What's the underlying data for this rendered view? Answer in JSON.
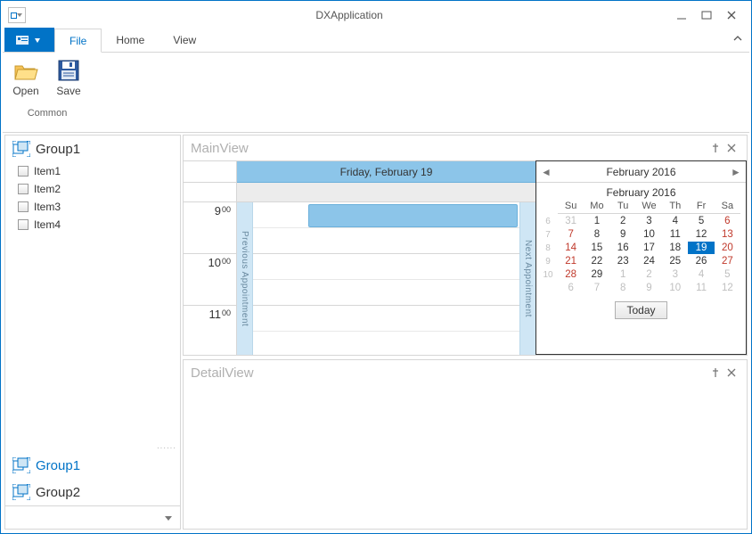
{
  "window": {
    "title": "DXApplication"
  },
  "ribbon": {
    "tabs": {
      "file": "File",
      "home": "Home",
      "view": "View"
    },
    "group_label": "Common",
    "open": "Open",
    "save": "Save"
  },
  "sidebar": {
    "group_top": "Group1",
    "items": [
      "Item1",
      "Item2",
      "Item3",
      "Item4"
    ],
    "group_a": "Group1",
    "group_b": "Group2"
  },
  "panels": {
    "main": "MainView",
    "detail": "DetailView"
  },
  "scheduler": {
    "day_header": "Friday, February 19",
    "times": [
      {
        "hour": "9",
        "min": "00"
      },
      {
        "hour": "10",
        "min": "00"
      },
      {
        "hour": "11",
        "min": "00"
      }
    ],
    "prev_label": "Previous Appointment",
    "next_label": "Next Appointment"
  },
  "calendar": {
    "nav_label": "February 2016",
    "month_label": "February 2016",
    "dow": [
      "Su",
      "Mo",
      "Tu",
      "We",
      "Th",
      "Fr",
      "Sa"
    ],
    "weeks": [
      {
        "wk": "6",
        "days": [
          {
            "d": "31",
            "o": true
          },
          {
            "d": "1"
          },
          {
            "d": "2"
          },
          {
            "d": "3"
          },
          {
            "d": "4"
          },
          {
            "d": "5"
          },
          {
            "d": "6",
            "we": true
          }
        ]
      },
      {
        "wk": "7",
        "days": [
          {
            "d": "7",
            "we": true
          },
          {
            "d": "8"
          },
          {
            "d": "9"
          },
          {
            "d": "10"
          },
          {
            "d": "11"
          },
          {
            "d": "12"
          },
          {
            "d": "13",
            "we": true
          }
        ]
      },
      {
        "wk": "8",
        "days": [
          {
            "d": "14",
            "we": true
          },
          {
            "d": "15"
          },
          {
            "d": "16"
          },
          {
            "d": "17"
          },
          {
            "d": "18"
          },
          {
            "d": "19",
            "sel": true
          },
          {
            "d": "20",
            "we": true
          }
        ]
      },
      {
        "wk": "9",
        "days": [
          {
            "d": "21",
            "we": true
          },
          {
            "d": "22"
          },
          {
            "d": "23"
          },
          {
            "d": "24"
          },
          {
            "d": "25"
          },
          {
            "d": "26"
          },
          {
            "d": "27",
            "we": true
          }
        ]
      },
      {
        "wk": "10",
        "days": [
          {
            "d": "28",
            "we": true
          },
          {
            "d": "29"
          },
          {
            "d": "1",
            "o": true
          },
          {
            "d": "2",
            "o": true
          },
          {
            "d": "3",
            "o": true
          },
          {
            "d": "4",
            "o": true
          },
          {
            "d": "5",
            "o": true
          }
        ]
      },
      {
        "wk": "",
        "days": [
          {
            "d": "6",
            "o": true
          },
          {
            "d": "7",
            "o": true
          },
          {
            "d": "8",
            "o": true
          },
          {
            "d": "9",
            "o": true
          },
          {
            "d": "10",
            "o": true
          },
          {
            "d": "11",
            "o": true
          },
          {
            "d": "12",
            "o": true
          }
        ]
      }
    ],
    "today": "Today"
  }
}
